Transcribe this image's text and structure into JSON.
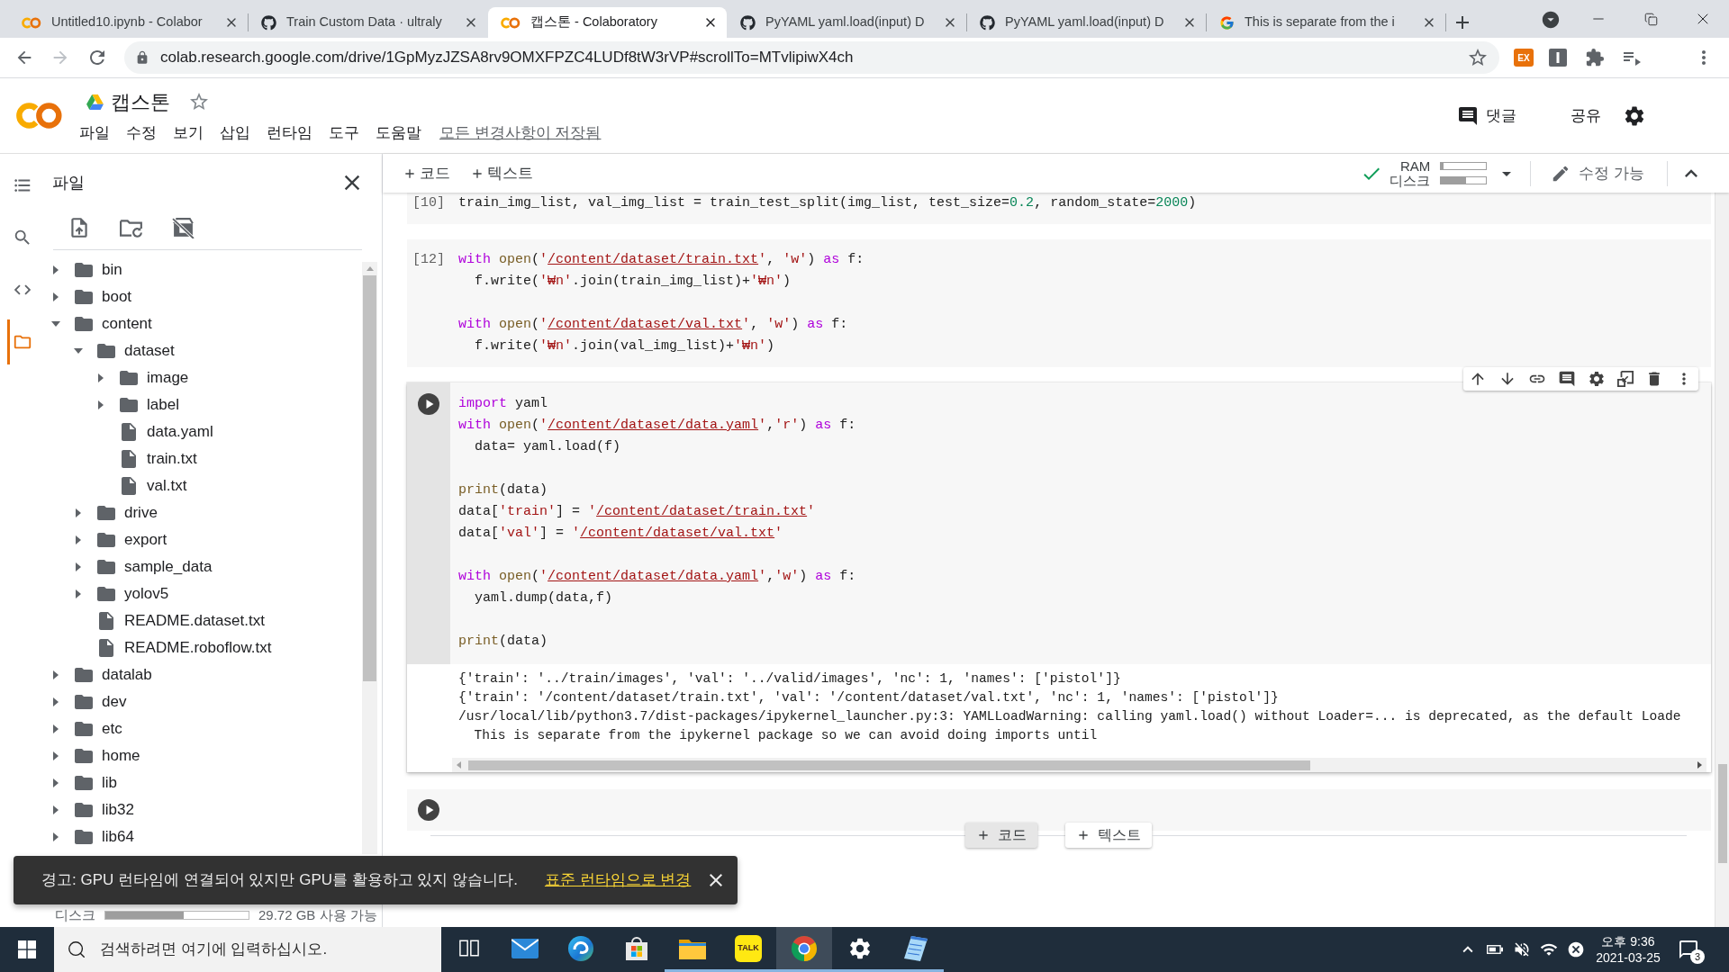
{
  "browser": {
    "tabs": [
      {
        "kind": "colab",
        "title": "Untitled10.ipynb - Colabor",
        "selected": false
      },
      {
        "kind": "github",
        "title": "Train Custom Data · ultraly",
        "selected": false
      },
      {
        "kind": "colab",
        "title": "캡스톤 - Colaboratory",
        "selected": true
      },
      {
        "kind": "github",
        "title": "PyYAML yaml.load(input) D",
        "selected": false
      },
      {
        "kind": "github",
        "title": "PyYAML yaml.load(input) D",
        "selected": false
      },
      {
        "kind": "google",
        "title": "This is separate from the i",
        "selected": false
      }
    ],
    "url": "colab.research.google.com/drive/1GpMyzJZSA8rv9OMXFPZC4LUDf8tW3rVP#scrollTo=MTvlipiwX4ch",
    "extension_badge": "EX"
  },
  "notebook": {
    "title": "캡스톤",
    "starred": false,
    "menu": [
      "파일",
      "수정",
      "보기",
      "삽입",
      "런타임",
      "도구",
      "도움말"
    ],
    "save_status": "모든 변경사항이 저장됨",
    "comment": "댓글",
    "share": "공유"
  },
  "toolbar": {
    "add": [
      "코드",
      "텍스트"
    ],
    "connected": true,
    "ram": {
      "label": "RAM",
      "level": 0.06
    },
    "disk": {
      "label": "디스크",
      "level": 0.55
    },
    "mode": "수정 가능"
  },
  "sidebar": {
    "rail": [
      {
        "kind": "toc",
        "selected": false
      },
      {
        "kind": "search",
        "selected": false
      },
      {
        "kind": "snippets",
        "selected": false
      },
      {
        "kind": "files",
        "selected": true
      }
    ],
    "files": {
      "title": "파일",
      "tree": [
        {
          "name": "bin",
          "kind": "folder",
          "expanded": false
        },
        {
          "name": "boot",
          "kind": "folder",
          "expanded": false
        },
        {
          "name": "content",
          "kind": "folder",
          "expanded": true,
          "children": [
            {
              "name": "dataset",
              "kind": "folder",
              "expanded": true,
              "children": [
                {
                  "name": "image",
                  "kind": "folder",
                  "expanded": false
                },
                {
                  "name": "label",
                  "kind": "folder",
                  "expanded": false
                },
                {
                  "name": "data.yaml",
                  "kind": "file"
                },
                {
                  "name": "train.txt",
                  "kind": "file"
                },
                {
                  "name": "val.txt",
                  "kind": "file"
                }
              ]
            },
            {
              "name": "drive",
              "kind": "folder",
              "expanded": false
            },
            {
              "name": "export",
              "kind": "folder",
              "expanded": false
            },
            {
              "name": "sample_data",
              "kind": "folder",
              "expanded": false
            },
            {
              "name": "yolov5",
              "kind": "folder",
              "expanded": false
            },
            {
              "name": "README.dataset.txt",
              "kind": "file"
            },
            {
              "name": "README.roboflow.txt",
              "kind": "file"
            }
          ]
        },
        {
          "name": "datalab",
          "kind": "folder",
          "expanded": false
        },
        {
          "name": "dev",
          "kind": "folder",
          "expanded": false
        },
        {
          "name": "etc",
          "kind": "folder",
          "expanded": false
        },
        {
          "name": "home",
          "kind": "folder",
          "expanded": false
        },
        {
          "name": "lib",
          "kind": "folder",
          "expanded": false
        },
        {
          "name": "lib32",
          "kind": "folder",
          "expanded": false
        },
        {
          "name": "lib64",
          "kind": "folder",
          "expanded": false
        }
      ],
      "disk": {
        "label": "디스크",
        "level": 0.55,
        "free": "29.72 GB 사용 가능"
      }
    }
  },
  "cells": [
    {
      "kind": "code",
      "execution_count": "[10]",
      "focused": false,
      "lines": [
        {
          "kind": "code",
          "tokens": [
            {
              "kind": "plain",
              "text": "train_img_list, val_img_list = train_test_split(img_list, test_size="
            },
            {
              "kind": "number",
              "text": "0.2"
            },
            {
              "kind": "plain",
              "text": ", random_state="
            },
            {
              "kind": "number",
              "text": "2000"
            },
            {
              "kind": "plain",
              "text": ")"
            }
          ]
        }
      ]
    },
    {
      "kind": "code",
      "execution_count": "[12]",
      "focused": false,
      "lines": [
        {
          "kind": "code",
          "tokens": [
            {
              "kind": "keyword",
              "text": "with "
            },
            {
              "kind": "builtin",
              "text": "open"
            },
            {
              "kind": "plain",
              "text": "("
            },
            {
              "kind": "string",
              "text": "'"
            },
            {
              "kind": "path",
              "text": "/content/dataset/train.txt"
            },
            {
              "kind": "string",
              "text": "'"
            },
            {
              "kind": "plain",
              "text": ", "
            },
            {
              "kind": "string",
              "text": "'w'"
            },
            {
              "kind": "plain",
              "text": ") "
            },
            {
              "kind": "keyword",
              "text": "as"
            },
            {
              "kind": "plain",
              "text": " f:"
            }
          ]
        },
        {
          "kind": "code",
          "tokens": [
            {
              "kind": "plain",
              "text": "  f.write("
            },
            {
              "kind": "string",
              "text": "'₩n'"
            },
            {
              "kind": "plain",
              "text": ".join(train_img_list)+"
            },
            {
              "kind": "string",
              "text": "'₩n'"
            },
            {
              "kind": "plain",
              "text": ")"
            }
          ]
        },
        {
          "kind": "blank"
        },
        {
          "kind": "code",
          "tokens": [
            {
              "kind": "keyword",
              "text": "with "
            },
            {
              "kind": "builtin",
              "text": "open"
            },
            {
              "kind": "plain",
              "text": "("
            },
            {
              "kind": "string",
              "text": "'"
            },
            {
              "kind": "path",
              "text": "/content/dataset/val.txt"
            },
            {
              "kind": "string",
              "text": "'"
            },
            {
              "kind": "plain",
              "text": ", "
            },
            {
              "kind": "string",
              "text": "'w'"
            },
            {
              "kind": "plain",
              "text": ") "
            },
            {
              "kind": "keyword",
              "text": "as"
            },
            {
              "kind": "plain",
              "text": " f:"
            }
          ]
        },
        {
          "kind": "code",
          "tokens": [
            {
              "kind": "plain",
              "text": "  f.write("
            },
            {
              "kind": "string",
              "text": "'₩n'"
            },
            {
              "kind": "plain",
              "text": ".join(val_img_list)+"
            },
            {
              "kind": "string",
              "text": "'₩n'"
            },
            {
              "kind": "plain",
              "text": ")"
            }
          ]
        }
      ]
    },
    {
      "kind": "code",
      "focused": true,
      "lines": [
        {
          "kind": "code",
          "tokens": [
            {
              "kind": "keyword",
              "text": "import"
            },
            {
              "kind": "plain",
              "text": " yaml"
            }
          ]
        },
        {
          "kind": "code",
          "tokens": [
            {
              "kind": "keyword",
              "text": "with "
            },
            {
              "kind": "builtin",
              "text": "open"
            },
            {
              "kind": "plain",
              "text": "("
            },
            {
              "kind": "string",
              "text": "'"
            },
            {
              "kind": "path",
              "text": "/content/dataset/data.yaml"
            },
            {
              "kind": "string",
              "text": "'"
            },
            {
              "kind": "plain",
              "text": ","
            },
            {
              "kind": "string",
              "text": "'r'"
            },
            {
              "kind": "plain",
              "text": ") "
            },
            {
              "kind": "keyword",
              "text": "as"
            },
            {
              "kind": "plain",
              "text": " f:"
            }
          ]
        },
        {
          "kind": "code",
          "tokens": [
            {
              "kind": "plain",
              "text": "  data= yaml.load(f)"
            }
          ]
        },
        {
          "kind": "blank"
        },
        {
          "kind": "code",
          "tokens": [
            {
              "kind": "builtin",
              "text": "print"
            },
            {
              "kind": "plain",
              "text": "(data)"
            }
          ]
        },
        {
          "kind": "code",
          "tokens": [
            {
              "kind": "plain",
              "text": "data["
            },
            {
              "kind": "string",
              "text": "'train'"
            },
            {
              "kind": "plain",
              "text": "] = "
            },
            {
              "kind": "string",
              "text": "'"
            },
            {
              "kind": "path",
              "text": "/content/dataset/train.txt"
            },
            {
              "kind": "string",
              "text": "'"
            }
          ]
        },
        {
          "kind": "code",
          "tokens": [
            {
              "kind": "plain",
              "text": "data["
            },
            {
              "kind": "string",
              "text": "'val'"
            },
            {
              "kind": "plain",
              "text": "] = "
            },
            {
              "kind": "string",
              "text": "'"
            },
            {
              "kind": "path",
              "text": "/content/dataset/val.txt"
            },
            {
              "kind": "string",
              "text": "'"
            }
          ]
        },
        {
          "kind": "blank"
        },
        {
          "kind": "code",
          "tokens": [
            {
              "kind": "keyword",
              "text": "with "
            },
            {
              "kind": "builtin",
              "text": "open"
            },
            {
              "kind": "plain",
              "text": "("
            },
            {
              "kind": "string",
              "text": "'"
            },
            {
              "kind": "path",
              "text": "/content/dataset/data.yaml"
            },
            {
              "kind": "string",
              "text": "'"
            },
            {
              "kind": "plain",
              "text": ","
            },
            {
              "kind": "string",
              "text": "'w'"
            },
            {
              "kind": "plain",
              "text": ") "
            },
            {
              "kind": "keyword",
              "text": "as"
            },
            {
              "kind": "plain",
              "text": " f:"
            }
          ]
        },
        {
          "kind": "code",
          "tokens": [
            {
              "kind": "plain",
              "text": "  yaml.dump(data,f)"
            }
          ]
        },
        {
          "kind": "blank"
        },
        {
          "kind": "code",
          "tokens": [
            {
              "kind": "builtin",
              "text": "print"
            },
            {
              "kind": "plain",
              "text": "(data)"
            }
          ]
        }
      ],
      "output": [
        "{'train': '../train/images', 'val': '../valid/images', 'nc': 1, 'names': ['pistol']}",
        "{'train': '/content/dataset/train.txt', 'val': '/content/dataset/val.txt', 'nc': 1, 'names': ['pistol']}",
        "/usr/local/lib/python3.7/dist-packages/ipykernel_launcher.py:3: YAMLLoadWarning: calling yaml.load() without Loader=... is deprecated, as the default Loade",
        "  This is separate from the ipykernel package so we can avoid doing imports until"
      ]
    },
    {
      "kind": "code",
      "focused": false
    }
  ],
  "add_cell": [
    {
      "label": "코드",
      "highlighted": true
    },
    {
      "label": "텍스트",
      "highlighted": false
    }
  ],
  "snackbar": {
    "message": "경고: GPU 런타임에 연결되어 있지만 GPU를 활용하고 있지 않습니다.",
    "action": "표준 런타임으로 변경"
  },
  "taskbar": {
    "search_placeholder": "검색하려면 여기에 입력하십시오.",
    "apps": [
      {
        "kind": "task-view",
        "running": false,
        "selected": false
      },
      {
        "kind": "mail",
        "running": false,
        "selected": false
      },
      {
        "kind": "swirl",
        "running": false,
        "selected": false
      },
      {
        "kind": "store",
        "running": false,
        "selected": false
      },
      {
        "kind": "folder",
        "running": true,
        "selected": false
      },
      {
        "kind": "talk",
        "label": "TALK",
        "running": true,
        "selected": false
      },
      {
        "kind": "tricolor",
        "running": true,
        "selected": true
      },
      {
        "kind": "settings",
        "running": true,
        "selected": false
      },
      {
        "kind": "notepad",
        "running": true,
        "selected": false
      }
    ],
    "clock": {
      "time": "오후 9:36",
      "date": "2021-03-25"
    },
    "notification_count": "3"
  }
}
